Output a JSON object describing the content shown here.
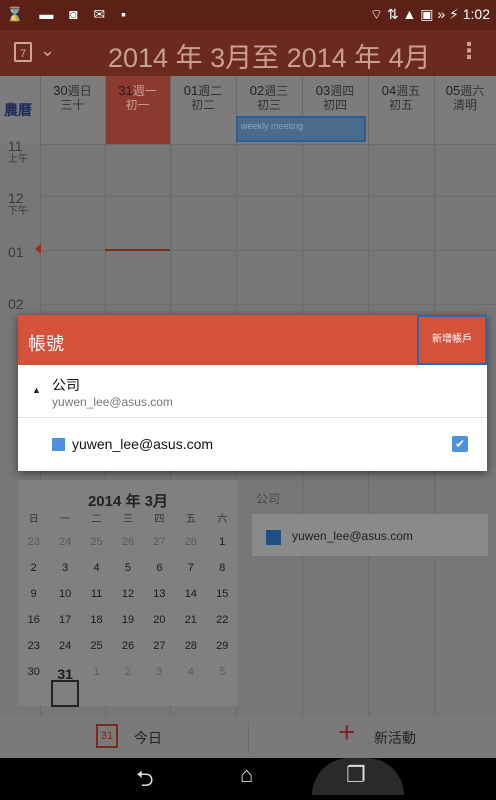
{
  "status_bar": {
    "left_icons": "⌛ ▬ ◙ ✉ ▪",
    "right_text": "⌔ ⇅ ▲ ▣ » ⚡ 1:02"
  },
  "app_bar": {
    "title": "2014 年 3月至 2014 年 4月",
    "cal_icon_num": "7",
    "chevron": "⌄",
    "menu": "⋮"
  },
  "grid": {
    "lunar_label": "農曆",
    "days": [
      {
        "date": "30",
        "weekday": "週日",
        "lunar": "三十"
      },
      {
        "date": "31",
        "weekday": "週一",
        "lunar": "初一"
      },
      {
        "date": "01",
        "weekday": "週二",
        "lunar": "初二"
      },
      {
        "date": "02",
        "weekday": "週三",
        "lunar": "初三"
      },
      {
        "date": "03",
        "weekday": "週四",
        "lunar": "初四"
      },
      {
        "date": "04",
        "weekday": "週五",
        "lunar": "初五"
      },
      {
        "date": "05",
        "weekday": "週六",
        "lunar": "清明"
      }
    ],
    "hours": [
      {
        "h": "11",
        "ampm": "上午"
      },
      {
        "h": "12",
        "ampm": "下午"
      },
      {
        "h": "01",
        "ampm": ""
      },
      {
        "h": "02",
        "ampm": ""
      }
    ],
    "event": "weekly meeting"
  },
  "dialog": {
    "title": "帳號",
    "add_account": "新增帳戶",
    "group_name": "公司",
    "group_email": "yuwen_lee@asus.com",
    "account_email": "yuwen_lee@asus.com",
    "checked": true,
    "check_glyph": "✔"
  },
  "mini_calendar": {
    "title": "2014 年 3月",
    "weekdays": [
      "日",
      "一",
      "二",
      "三",
      "四",
      "五",
      "六"
    ],
    "weeks": [
      [
        "23",
        "24",
        "25",
        "26",
        "27",
        "28",
        "1"
      ],
      [
        "2",
        "3",
        "4",
        "5",
        "6",
        "7",
        "8"
      ],
      [
        "9",
        "10",
        "11",
        "12",
        "13",
        "14",
        "15"
      ],
      [
        "16",
        "17",
        "18",
        "19",
        "20",
        "21",
        "22"
      ],
      [
        "23",
        "24",
        "25",
        "26",
        "27",
        "28",
        "29"
      ],
      [
        "30",
        "31",
        "1",
        "2",
        "3",
        "4",
        "5"
      ]
    ],
    "today": "31"
  },
  "account_panel": {
    "label": "公司",
    "email": "yuwen_lee@asus.com"
  },
  "bottom_bar": {
    "today_label": "今日",
    "today_icon": "31",
    "new_label": "新活動",
    "plus_glyph": "+"
  },
  "nav_bar": {
    "back": "⮌",
    "home": "⌂",
    "recents": "❐"
  }
}
